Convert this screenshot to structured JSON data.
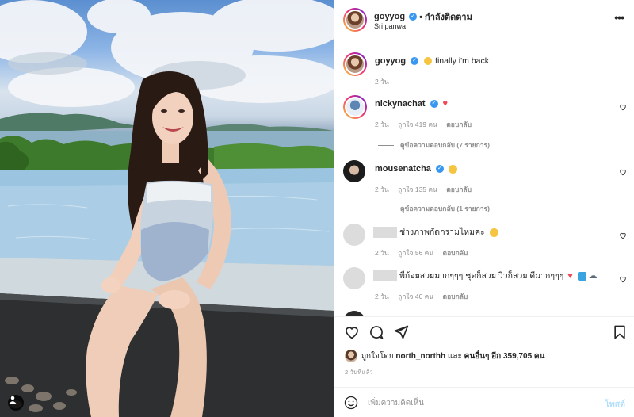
{
  "post": {
    "author": "goyyog",
    "follow_status": "• กำลังติดตาม",
    "location": "Sri panwa",
    "more_icon": "more-horizontal-icon",
    "caption": "finally i'm back",
    "caption_age": "2 วัน"
  },
  "comments": [
    {
      "user": "nickynachat",
      "text": "",
      "emoji": "red-heart",
      "age": "2 วัน",
      "likes": "ถูกใจ 419 คน",
      "reply": "ตอบกลับ",
      "view_replies": "ดูข้อความตอบกลับ (7 รายการ)"
    },
    {
      "user": "mousenatcha",
      "text": "",
      "emoji": "star-struck-face",
      "age": "2 วัน",
      "likes": "ถูกใจ 135 คน",
      "reply": "ตอบกลับ",
      "view_replies": "ดูข้อความตอบกลับ (1 รายการ)"
    },
    {
      "user": "",
      "text": "ช่างภาพกัดกรามไหมคะ",
      "emoji": "grinning-face",
      "age": "2 วัน",
      "likes": "ถูกใจ 56 คน",
      "reply": "ตอบกลับ"
    },
    {
      "user": "",
      "text": "พี่ก้อยสวยมากๆๆๆ ชุดก็สวย วิวก็สวย ดีมากๆๆๆ",
      "emoji": "heart-wave-cloud",
      "age": "2 วัน",
      "likes": "ถูกใจ 40 คน",
      "reply": "ตอบกลับ"
    }
  ],
  "likes_line": {
    "prefix": "ถูกใจโดย",
    "user": "north_northh",
    "mid": "และ",
    "others": "คนอื่นๆ อีก 359,705 คน"
  },
  "time_ago": "2 วันที่แล้ว",
  "composer": {
    "placeholder": "เพิ่มความคิดเห็น",
    "post_label": "โพสต์"
  },
  "colors": {
    "link_blue": "#3897f0",
    "post_disabled": "#b2dffc",
    "meta_grey": "#8e8e8e"
  }
}
